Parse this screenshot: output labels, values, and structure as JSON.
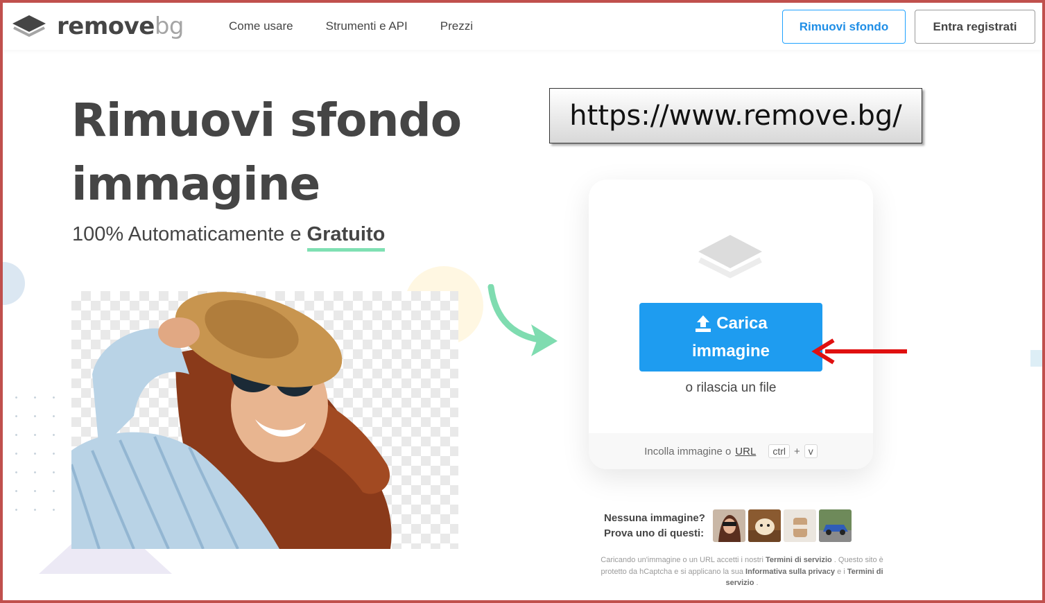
{
  "brand": {
    "name_primary": "remove",
    "name_secondary": "bg"
  },
  "nav": {
    "items": [
      "Come usare",
      "Strumenti e API",
      "Prezzi"
    ]
  },
  "header_buttons": {
    "primary": "Rimuovi sfondo",
    "secondary": "Entra registrati"
  },
  "hero": {
    "title_line1": "Rimuovi sfondo",
    "title_line2": "immagine",
    "subtitle_prefix": "100% Automaticamente e ",
    "subtitle_emphasis": "Gratuito"
  },
  "annotation": {
    "url": "https://www.remove.bg/"
  },
  "upload": {
    "button_line1": "Carica",
    "button_line2": "immagine",
    "drop_text": "o rilascia un file",
    "paste_prefix": "Incolla immagine o ",
    "paste_link": "URL",
    "key_ctrl": "ctrl",
    "key_plus": "+",
    "key_v": "v"
  },
  "samples": {
    "label_line1": "Nessuna immagine?",
    "label_line2": "Prova uno di questi:",
    "thumbnails": [
      "woman-sample",
      "dog-sample",
      "cup-sample",
      "car-sample"
    ]
  },
  "legal": {
    "t1": "Caricando un'immagine o un URL accetti i nostri ",
    "terms": "Termini di servizio",
    "t2": " . Questo sito è protetto da hCaptcha e si applicano la sua ",
    "privacy": "Informativa sulla privacy",
    "t3": " e i ",
    "terms2": "Termini di servizio",
    "t4": " ."
  },
  "colors": {
    "accent_blue": "#1e9cf0",
    "text_dark": "#454545",
    "underline_green": "#7fe0b3",
    "annotation_red": "#e01010",
    "frame_red": "#c0504d"
  }
}
